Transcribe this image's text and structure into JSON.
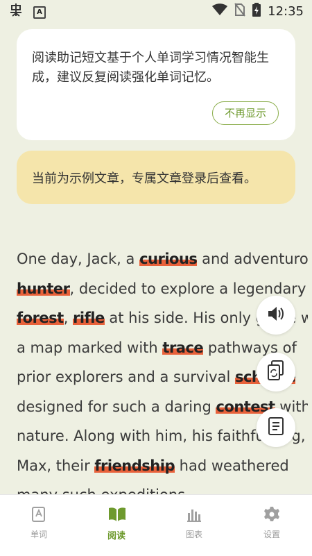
{
  "status_bar": {
    "time": "12:35",
    "a_badge": "A"
  },
  "info_card": {
    "text": "阅读助记短文基于个人单词学习情况智能生成，建议反复阅读强化单词记忆。",
    "dismiss_label": "不再显示"
  },
  "notice_card": {
    "text": "当前为示例文章，专属文章登录后查看。"
  },
  "article": {
    "lines": [
      [
        "One day, Jack, a ",
        {
          "w": "curious"
        },
        " and adventurous"
      ],
      [
        {
          "w": "hunter"
        },
        ", decided to explore a legendary"
      ],
      [
        {
          "w": "forest"
        },
        ", ",
        {
          "w": "rifle"
        },
        " at his side. His only guide was"
      ],
      [
        "a map marked with ",
        {
          "w": "trace"
        },
        " pathways of"
      ],
      [
        "prior explorers and a survival ",
        {
          "w": "scheme"
        }
      ],
      [
        "designed for such a daring ",
        {
          "w": "contest"
        },
        " with"
      ],
      [
        "nature. Along with him, his faithful dog,"
      ],
      [
        "Max, their ",
        {
          "w": "friendship"
        },
        " had weathered"
      ],
      [
        "many such expeditions."
      ]
    ]
  },
  "fabs": {
    "speaker": "speaker-icon",
    "copy_refresh": "copy-refresh-icon",
    "document": "document-icon"
  },
  "bottom_nav": {
    "items": [
      {
        "label": "单词",
        "icon": "word-book-icon",
        "active": false
      },
      {
        "label": "阅读",
        "icon": "open-book-icon",
        "active": true
      },
      {
        "label": "图表",
        "icon": "bar-chart-icon",
        "active": false
      },
      {
        "label": "设置",
        "icon": "gear-icon",
        "active": false
      }
    ]
  },
  "colors": {
    "accent": "#6e9a2e",
    "highlight": "#e8613a",
    "background": "#eef0e2",
    "notice": "#f5e5ab"
  }
}
